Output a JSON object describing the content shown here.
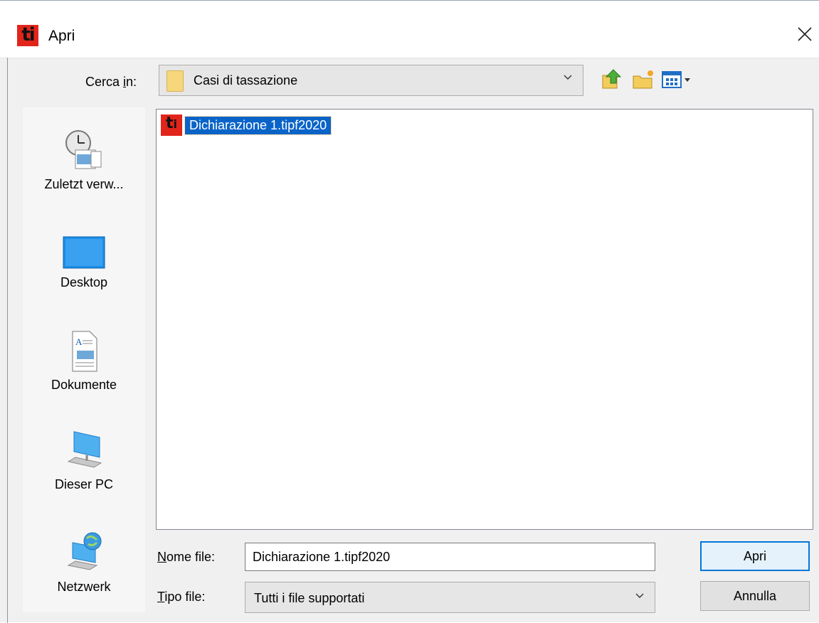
{
  "window": {
    "title": "Apri",
    "app_icon_text": "ti"
  },
  "lookin": {
    "label_pre": "Cerca ",
    "label_accel": "i",
    "label_post": "n:",
    "value": "Casi di tassazione"
  },
  "toolbar": {
    "up_icon": "folder-up-icon",
    "new_folder_icon": "new-folder-icon",
    "view_icon": "view-menu-icon"
  },
  "places": [
    {
      "label": "Zuletzt verw...",
      "icon": "recent-places-icon"
    },
    {
      "label": "Desktop",
      "icon": "desktop-icon"
    },
    {
      "label": "Dokumente",
      "icon": "documents-icon"
    },
    {
      "label": "Dieser PC",
      "icon": "computer-icon"
    },
    {
      "label": "Netzwerk",
      "icon": "network-icon"
    }
  ],
  "files": [
    {
      "name": "Dichiarazione 1.tipf2020",
      "selected": true
    }
  ],
  "filename": {
    "label_accel": "N",
    "label_post": "ome file:",
    "value": "Dichiarazione 1.tipf2020"
  },
  "filetype": {
    "label_accel": "T",
    "label_post": "ipo file:",
    "value": "Tutti i file supportati"
  },
  "buttons": {
    "open": "Apri",
    "cancel": "Annulla"
  },
  "colors": {
    "selection": "#0a64c8",
    "app_red": "#e1251b",
    "default_button_border": "#0078d7"
  }
}
